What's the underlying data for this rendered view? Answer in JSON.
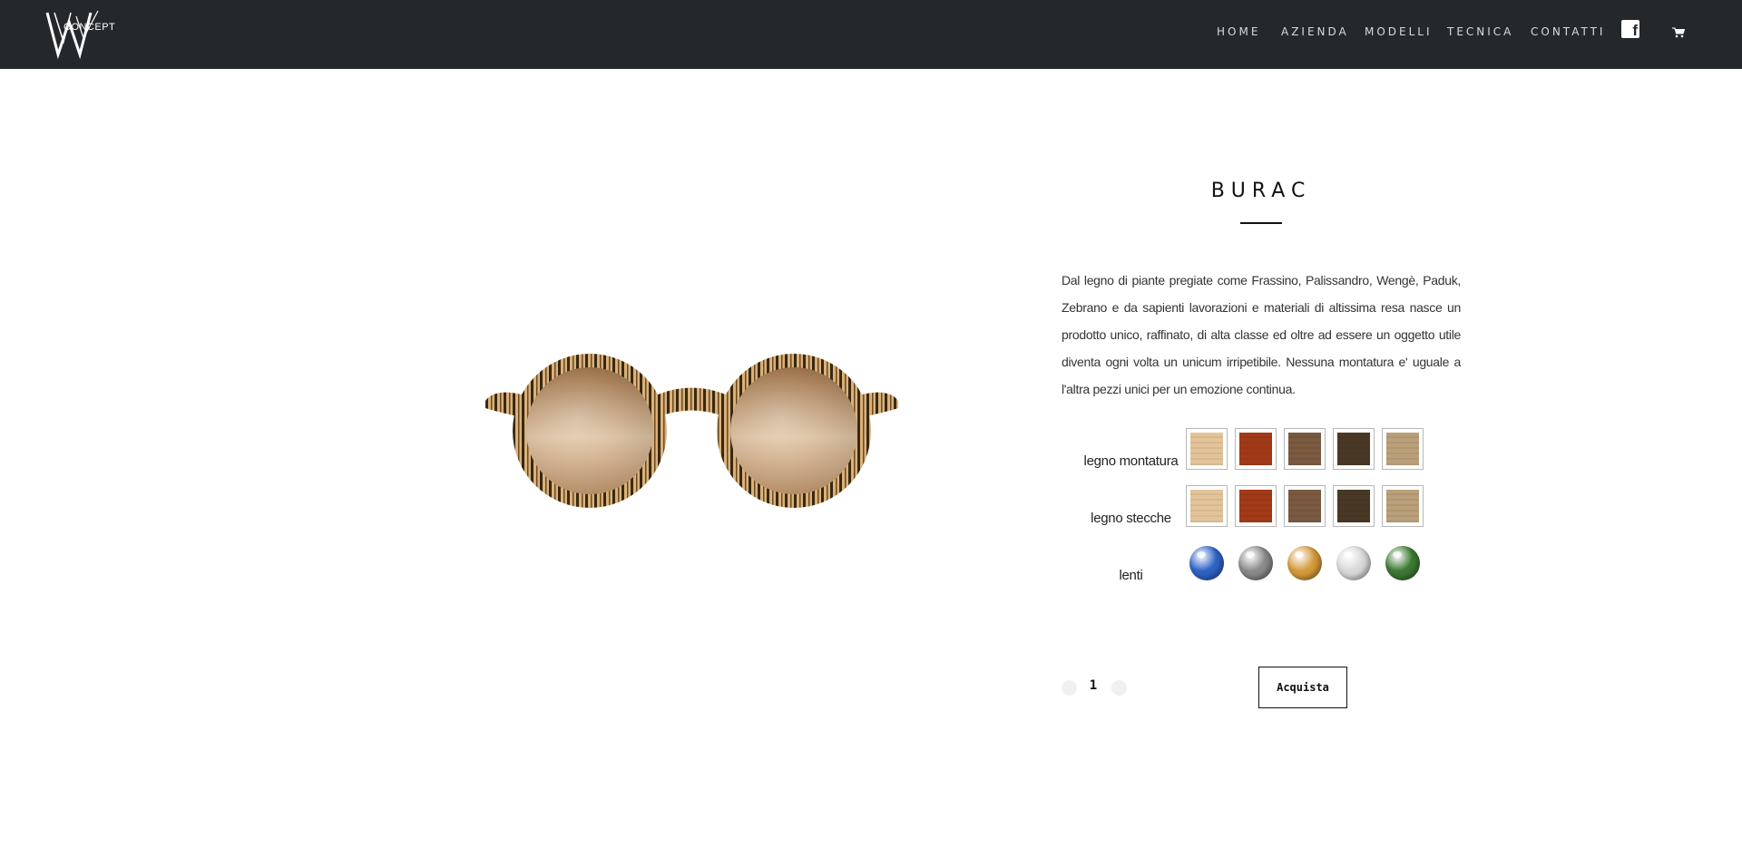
{
  "header": {
    "logo_text": "CONCEPT",
    "nav": [
      {
        "label": "HOME"
      },
      {
        "label": "AZIENDA"
      },
      {
        "label": "MODELLI"
      },
      {
        "label": "TECNICA"
      },
      {
        "label": "CONTATTI"
      }
    ],
    "icons": [
      "facebook-icon",
      "cart-icon"
    ]
  },
  "product": {
    "title": "BURAC",
    "description": "Dal legno di piante pregiate come Frassino, Palissandro, Wengè, Paduk, Zebrano e da sapienti lavorazioni e materiali di altissima resa nasce un prodotto unico, raffinato, di alta classe ed oltre ad essere un oggetto utile diventa ogni volta un unicum irripetibile. Nessuna montatura e' uguale a l'altra pezzi unici per un emozione continua.",
    "options": {
      "frame_label": "legno montatura",
      "temples_label": "legno stecche",
      "lens_label": "lenti"
    },
    "wood_colors": [
      "#e3c49a",
      "#a23a18",
      "#7a5a40",
      "#4a3826",
      "#b9a07a"
    ],
    "lens_colors": [
      "#2f63c5",
      "#8a8a8a",
      "#d49a3a",
      "#d8d8d8",
      "#3c7a33"
    ],
    "quantity": "1",
    "buy_label": "Acquista"
  },
  "colors": {
    "header_bg": "#25282b",
    "nav_text": "#d9d9d9",
    "text": "#222222"
  }
}
